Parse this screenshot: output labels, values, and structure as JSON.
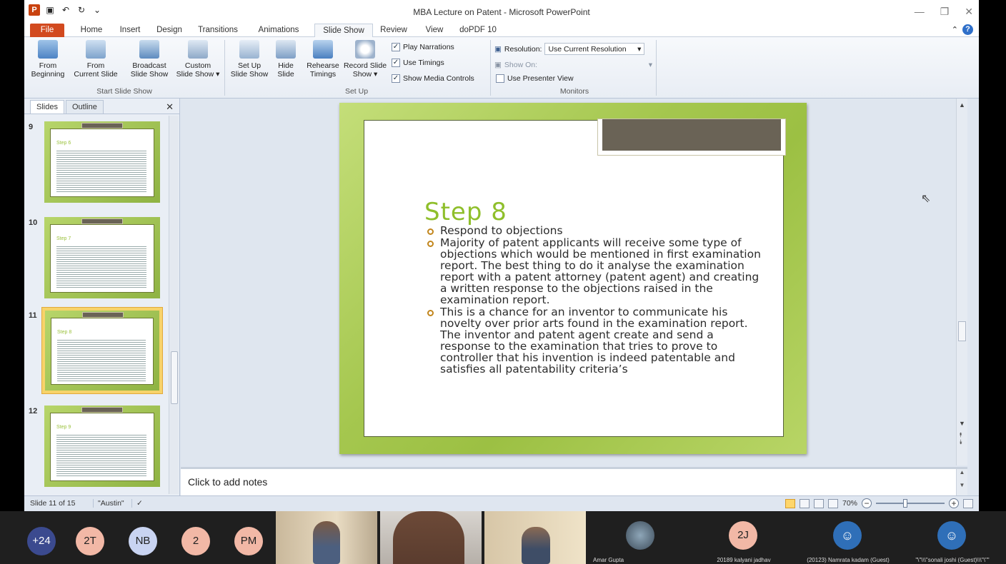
{
  "window": {
    "title": "MBA Lecture on Patent - Microsoft PowerPoint",
    "app_icon": "P",
    "qat_icons": [
      "save-icon",
      "undo-icon",
      "redo-icon",
      "customize-icon"
    ]
  },
  "tabs": [
    "File",
    "Home",
    "Insert",
    "Design",
    "Transitions",
    "Animations",
    "Slide Show",
    "Review",
    "View",
    "doPDF 10"
  ],
  "active_tab": "Slide Show",
  "ribbon": {
    "start": {
      "label": "Start Slide Show",
      "buttons": [
        {
          "l1": "From",
          "l2": "Beginning"
        },
        {
          "l1": "From",
          "l2": "Current Slide"
        },
        {
          "l1": "Broadcast",
          "l2": "Slide Show"
        },
        {
          "l1": "Custom",
          "l2": "Slide Show ▾"
        }
      ]
    },
    "setup": {
      "label": "Set Up",
      "buttons": [
        {
          "l1": "Set Up",
          "l2": "Slide Show"
        },
        {
          "l1": "Hide",
          "l2": "Slide"
        },
        {
          "l1": "Rehearse",
          "l2": "Timings"
        },
        {
          "l1": "Record Slide",
          "l2": "Show ▾"
        }
      ],
      "checks": [
        {
          "label": "Play Narrations",
          "checked": true
        },
        {
          "label": "Use Timings",
          "checked": true
        },
        {
          "label": "Show Media Controls",
          "checked": true
        }
      ]
    },
    "monitors": {
      "label": "Monitors",
      "resolution_label": "Resolution:",
      "resolution_value": "Use Current Resolution",
      "show_on_label": "Show On:",
      "presenter_label": "Use Presenter View"
    }
  },
  "pane": {
    "tabs": [
      "Slides",
      "Outline"
    ],
    "thumbs": [
      {
        "num": "9",
        "title": "Step 6"
      },
      {
        "num": "10",
        "title": "Step 7"
      },
      {
        "num": "11",
        "title": "Step 8"
      },
      {
        "num": "12",
        "title": "Step 9"
      }
    ]
  },
  "slide": {
    "title": "Step 8",
    "bullets": [
      "Respond to objections",
      "Majority of patent applicants will receive some type of objections which would be mentioned in first examination report. The best thing to do it analyse the examination report with a patent attorney (patent agent) and creating a written response to the objections raised in the examination report.",
      "This is a chance for an inventor to communicate his novelty over prior arts found in the examination report. The inventor and patent agent create and send a response to the examination that tries to prove to controller that his invention is indeed patentable and satisfies all patentability criteria’s"
    ]
  },
  "notes_placeholder": "Click to add notes",
  "status": {
    "slide": "Slide 11 of 15",
    "theme": "\"Austin\"",
    "zoom": "70%"
  },
  "meeting": {
    "avatars": [
      {
        "label": "+24",
        "color": "#3b4a8f",
        "text_color": "#ffffff"
      },
      {
        "label": "2T",
        "color": "#f2b8a6",
        "text_color": "#222222"
      },
      {
        "label": "NB",
        "color": "#c9d4f2",
        "text_color": "#222222"
      },
      {
        "label": "2",
        "color": "#f2b8a6",
        "text_color": "#222222"
      },
      {
        "label": "PM",
        "color": "#f2b8a6",
        "text_color": "#222222"
      }
    ],
    "named_tiles": [
      {
        "name": "Amar Gupta"
      },
      {
        "name": "20189 kalyani jadhav",
        "initials": "2J"
      },
      {
        "name": "(20123) Namrata kadam (Guest)"
      },
      {
        "name": "\"\\\"\\\\\\\"sonali joshi (Guest)\\\\\\\"\\\"\""
      }
    ]
  }
}
